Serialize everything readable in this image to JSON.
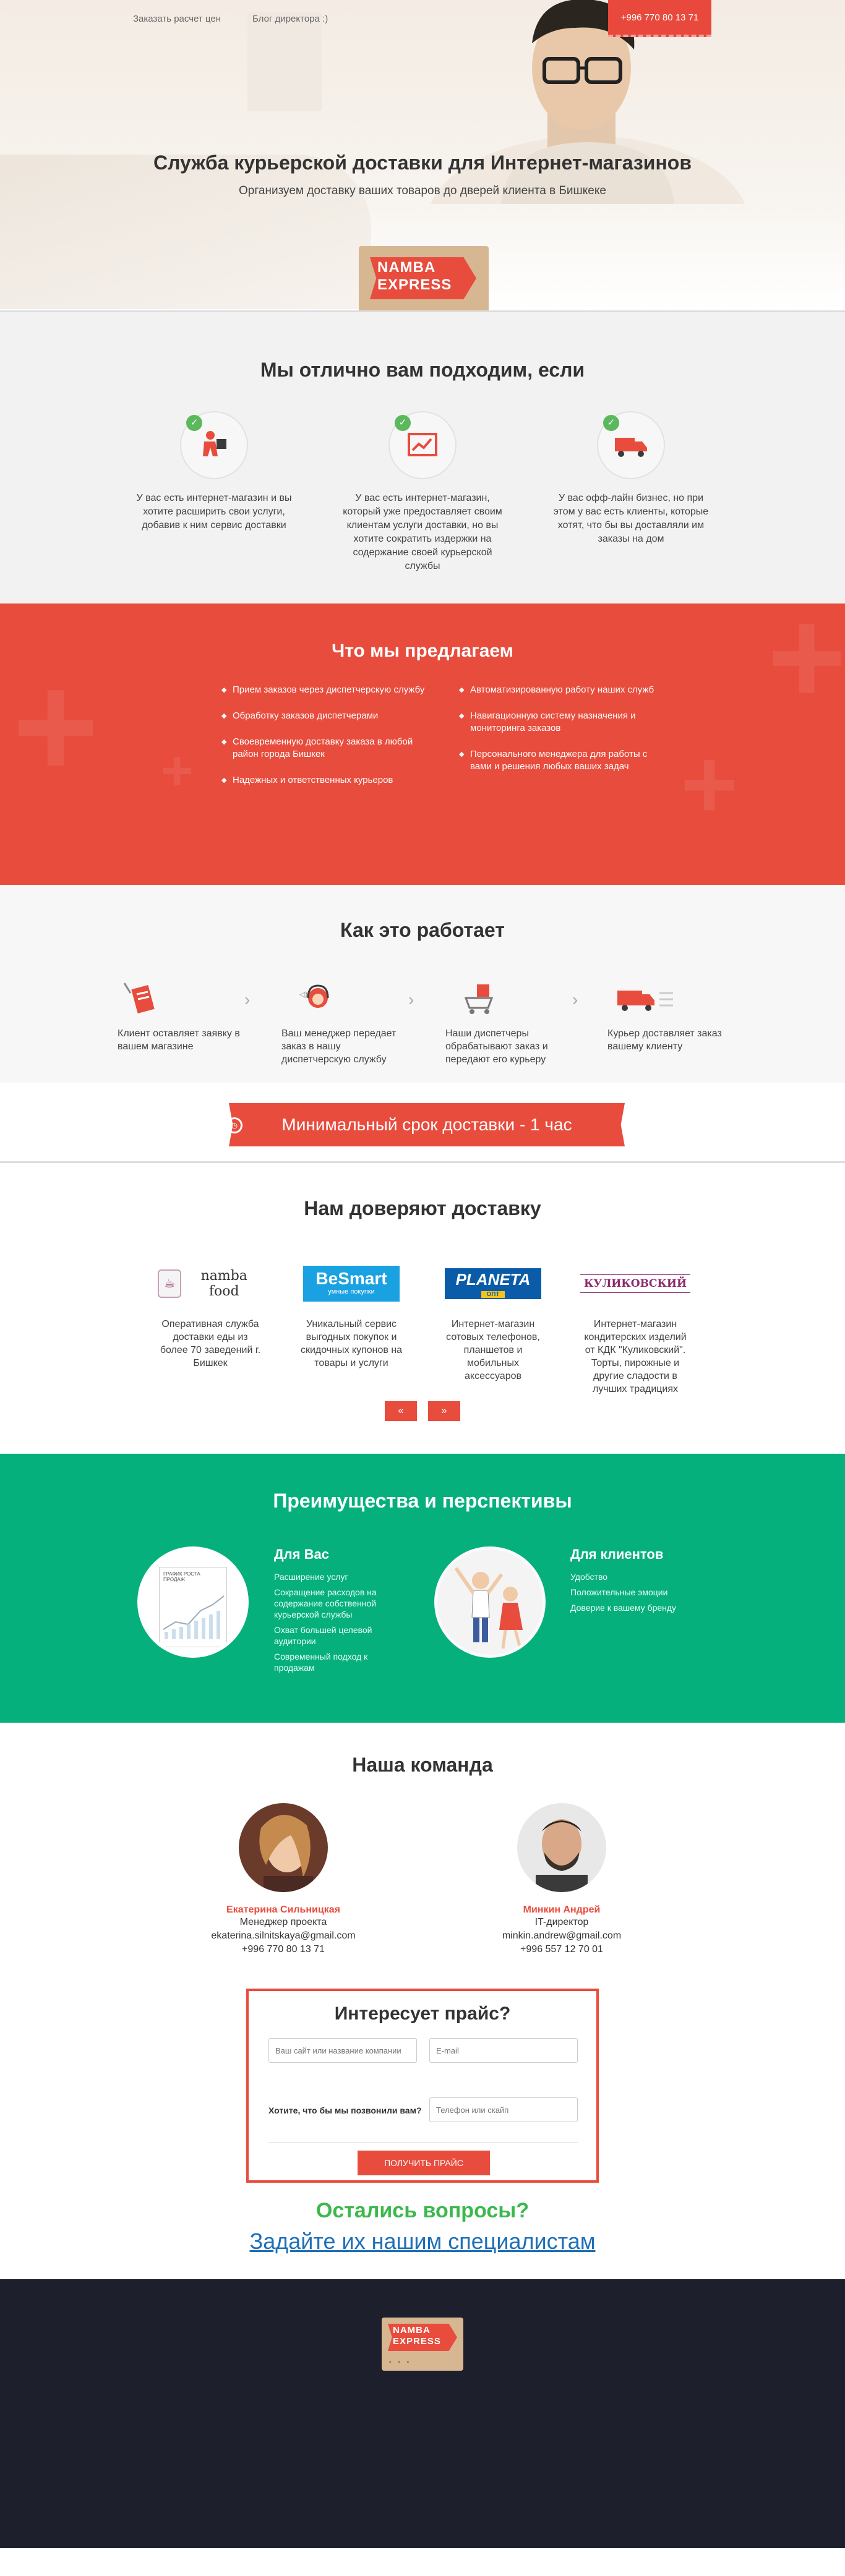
{
  "header": {
    "links": [
      "Заказать расчет цен",
      "Блог директора :)"
    ],
    "phone": "+996 770 80 13 71",
    "title": "Служба курьерской доставки для Интернет-магазинов",
    "subtitle": "Организуем доставку ваших товаров до дверей клиента в Бишкеке",
    "logo_lines": [
      "NAMBA",
      "EXPRESS"
    ]
  },
  "fit": {
    "title": "Мы отлично вам подходим, если",
    "items": [
      {
        "icon": "person-package-icon",
        "text": "У вас есть интернет-магазин и вы хотите расширить свои услуги, добавив к ним сервис доставки"
      },
      {
        "icon": "chart-icon",
        "text": "У вас есть интернет-магазин, который уже предоставляет своим клиентам услуги доставки, но вы хотите сократить издержки на содержание своей курьерской службы"
      },
      {
        "icon": "truck-icon",
        "text": "У вас офф-лайн бизнес, но при этом у вас есть клиенты, которые хотят, что бы вы доставляли им заказы на дом"
      }
    ]
  },
  "offer": {
    "title": "Что мы предлагаем",
    "left": [
      "Прием заказов через диспетчерскую службу",
      "Обработку заказов диспетчерами",
      "Своевременную доставку заказа в любой район города Бишкек",
      "Надежных и ответственных курьеров"
    ],
    "right": [
      "Автоматизированную работу наших служб",
      "Навигационную систему назначения и мониторинга заказов",
      "Персонального менеджера для работы с вами и решения любых ваших задач"
    ]
  },
  "how": {
    "title": "Как это работает",
    "steps": [
      {
        "icon": "order-form-icon",
        "text": "Клиент оставляет заявку в вашем магазине"
      },
      {
        "icon": "manager-headset-icon",
        "text": "Ваш менеджер передает заказ в нашу диспетчерскую службу"
      },
      {
        "icon": "dispatcher-cart-icon",
        "text": "Наши диспетчеры обрабатывают заказ и передают его курьеру"
      },
      {
        "icon": "delivery-truck-icon",
        "text": "Курьер доставляет заказ вашему клиенту"
      }
    ]
  },
  "min_delivery": "Минимальный срок доставки - 1 час",
  "trust": {
    "title": "Нам доверяют доставку",
    "partners": [
      {
        "logo": "namba food",
        "text": "Оперативная служба доставки еды из более 70 заведений г. Бишкек"
      },
      {
        "logo": "BeSmart",
        "logo_sub": "умные покупки",
        "text": "Уникальный сервис выгодных покупок и скидочных купонов на товары и услуги"
      },
      {
        "logo": "PLANETA",
        "logo_sub": "ОПТ",
        "text": "Интернет-магазин сотовых телефонов, планшетов и мобильных аксессуаров"
      },
      {
        "logo": "КУЛИКОВСКИЙ",
        "text": "Интернет-магазин кондитерских изделий от КДК \"Куликовский\". Торты, пирожные и другие сладости в лучших традициях"
      }
    ],
    "prev": "«",
    "next": "»"
  },
  "benefits": {
    "title": "Преимущества и перспективы",
    "for_you_title": "Для Вас",
    "for_you": [
      "Расширение услуг",
      "Сокращение расходов на содержание собственной курьерской службы",
      "Охват большей целевой аудитории",
      "Современный подход к продажам"
    ],
    "chart_caption": "ГРАФИК РОСТА ПРОДАЖ",
    "for_clients_title": "Для клиентов",
    "for_clients": [
      "Удобство",
      "Положительные эмоции",
      "Доверие к вашему бренду"
    ]
  },
  "team": {
    "title": "Наша команда",
    "members": [
      {
        "name": "Екатерина Сильницкая",
        "role": "Менеджер проекта",
        "email": "ekaterina.silnitskaya@gmail.com",
        "phone": "+996 770 80 13 71"
      },
      {
        "name": "Минкин Андрей",
        "role": "IT-директор",
        "email": "minkin.andrew@gmail.com",
        "phone": "+996 557 12 70 01"
      }
    ]
  },
  "price": {
    "title": "Интересует прайс?",
    "site_placeholder": "Ваш сайт или название компании",
    "email_placeholder": "E-mail",
    "call_label": "Хотите, что бы мы позвонили вам?",
    "phone_placeholder": "Телефон или скайп",
    "button": "ПОЛУЧИТЬ ПРАЙС"
  },
  "questions": {
    "line1": "Остались вопросы?",
    "line2": "Задайте их нашим специалистам"
  },
  "colors": {
    "accent": "#e84c3d",
    "green": "#06b07d",
    "footer": "#1d1f2c",
    "link": "#1e6fb8"
  }
}
